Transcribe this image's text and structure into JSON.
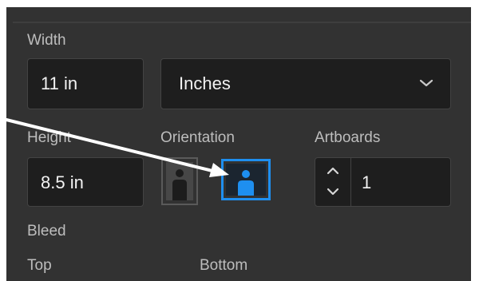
{
  "width": {
    "label": "Width",
    "value": "11 in"
  },
  "units": {
    "value": "Inches"
  },
  "height": {
    "label": "Height",
    "value": "8.5 in"
  },
  "orientation": {
    "label": "Orientation",
    "selected": "landscape",
    "accent": "#1e8ff0"
  },
  "artboards": {
    "label": "Artboards",
    "value": "1"
  },
  "bleed": {
    "label": "Bleed",
    "top_label": "Top",
    "bottom_label": "Bottom"
  },
  "annotation": {
    "arrow_color": "#ffffff"
  }
}
